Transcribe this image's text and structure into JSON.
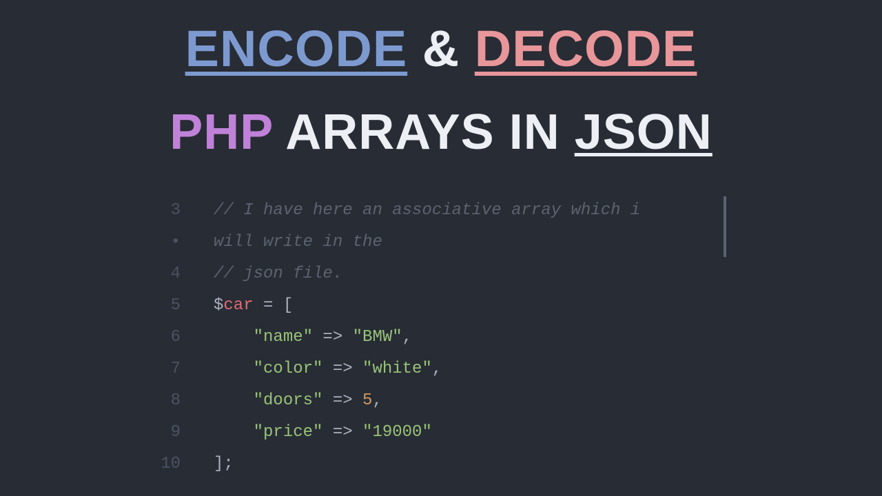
{
  "title": {
    "encode": "ENCODE",
    "amp": "&",
    "decode": "DECODE",
    "php": "PHP",
    "arrays_in": " ARRAYS IN ",
    "json": "JSON"
  },
  "code": {
    "lines": [
      {
        "num": "3",
        "spans": [
          {
            "cls": "tok-comment",
            "t": "// I have here an associative array which i"
          }
        ]
      },
      {
        "num": "•",
        "spans": [
          {
            "cls": "tok-comment",
            "t": "will write in the"
          }
        ]
      },
      {
        "num": "4",
        "spans": [
          {
            "cls": "tok-comment",
            "t": "// json file."
          }
        ]
      },
      {
        "num": "5",
        "spans": [
          {
            "cls": "tok-punc",
            "t": "$"
          },
          {
            "cls": "tok-var",
            "t": "car"
          },
          {
            "cls": "tok-op",
            "t": " = "
          },
          {
            "cls": "tok-punc",
            "t": "["
          }
        ]
      },
      {
        "num": "6",
        "spans": [
          {
            "cls": "tok-punc",
            "t": "    "
          },
          {
            "cls": "tok-str",
            "t": "\"name\""
          },
          {
            "cls": "tok-op",
            "t": " => "
          },
          {
            "cls": "tok-str",
            "t": "\"BMW\""
          },
          {
            "cls": "tok-punc",
            "t": ","
          }
        ]
      },
      {
        "num": "7",
        "spans": [
          {
            "cls": "tok-punc",
            "t": "    "
          },
          {
            "cls": "tok-str",
            "t": "\"color\""
          },
          {
            "cls": "tok-op",
            "t": " => "
          },
          {
            "cls": "tok-str",
            "t": "\"white\""
          },
          {
            "cls": "tok-punc",
            "t": ","
          }
        ]
      },
      {
        "num": "8",
        "spans": [
          {
            "cls": "tok-punc",
            "t": "    "
          },
          {
            "cls": "tok-str",
            "t": "\"doors\""
          },
          {
            "cls": "tok-op",
            "t": " => "
          },
          {
            "cls": "tok-num",
            "t": "5"
          },
          {
            "cls": "tok-punc",
            "t": ","
          }
        ]
      },
      {
        "num": "9",
        "spans": [
          {
            "cls": "tok-punc",
            "t": "    "
          },
          {
            "cls": "tok-str",
            "t": "\"price\""
          },
          {
            "cls": "tok-op",
            "t": " => "
          },
          {
            "cls": "tok-str",
            "t": "\"19000\""
          }
        ]
      },
      {
        "num": "10",
        "spans": [
          {
            "cls": "tok-punc",
            "t": "];"
          }
        ]
      }
    ]
  },
  "colors": {
    "bg": "#282c34",
    "encode": "#7d9ad0",
    "decode": "#e8969a",
    "php": "#c082d9",
    "comment": "#5c6370",
    "string": "#98c379",
    "number": "#d19a66",
    "variable": "#e06c75",
    "default": "#abb2bf",
    "gutter": "#4b5263"
  }
}
